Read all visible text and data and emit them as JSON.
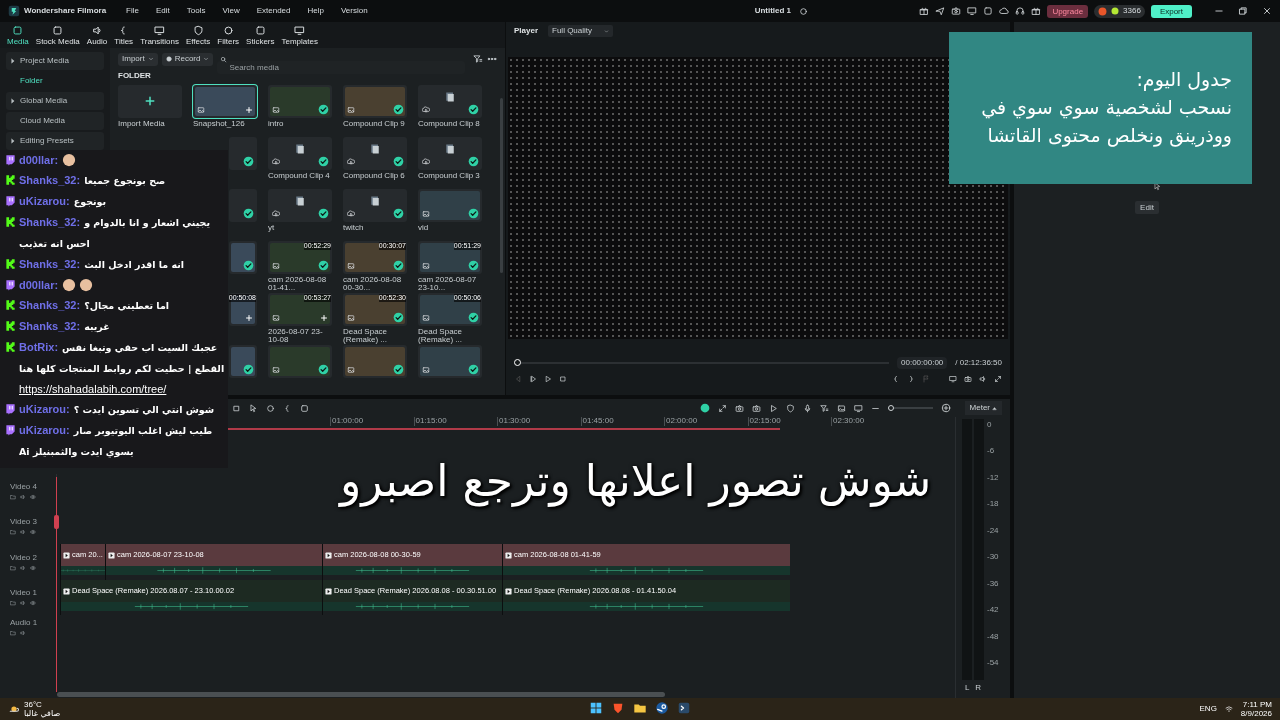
{
  "title_bar": {
    "app_name": "Wondershare Filmora",
    "menu": [
      "File",
      "Edit",
      "Tools",
      "View",
      "Extended",
      "Help",
      "Version"
    ],
    "project_title": "Untitled 1",
    "upgrade": "Upgrade",
    "credits": "3366",
    "export": "Export"
  },
  "tabs": [
    {
      "label": "Media",
      "selected": true
    },
    {
      "label": "Stock Media",
      "selected": false
    },
    {
      "label": "Audio",
      "selected": false
    },
    {
      "label": "Titles",
      "selected": false
    },
    {
      "label": "Transitions",
      "selected": false
    },
    {
      "label": "Effects",
      "selected": false
    },
    {
      "label": "Filters",
      "selected": false
    },
    {
      "label": "Stickers",
      "selected": false
    },
    {
      "label": "Templates",
      "selected": false
    }
  ],
  "sidebar": {
    "items": [
      {
        "label": "Project Media",
        "kind": "group",
        "selected": false
      },
      {
        "label": "Folder",
        "kind": "sub",
        "selected": true
      },
      {
        "label": "Global Media",
        "kind": "group",
        "selected": false
      },
      {
        "label": "Cloud Media",
        "kind": "plain",
        "selected": false
      },
      {
        "label": "Editing Presets",
        "kind": "group",
        "selected": false
      }
    ]
  },
  "media": {
    "import": "Import",
    "record": "Record",
    "search": {
      "placeholder": "Search media"
    },
    "section": "FOLDER",
    "items": [
      {
        "kind": "import",
        "label": "Import Media",
        "selected": false
      },
      {
        "kind": "photo",
        "label": "Snapshot_126",
        "selected": true,
        "added": false
      },
      {
        "kind": "photo",
        "label": "intro",
        "selected": false,
        "added": true
      },
      {
        "kind": "photo",
        "label": "Compound Clip 9",
        "selected": false,
        "added": true
      },
      {
        "kind": "compound",
        "label": "Compound Clip 8",
        "selected": false,
        "added": true
      },
      {
        "kind": "covered"
      },
      {
        "kind": "compound",
        "cut": true,
        "selected": false,
        "added": true
      },
      {
        "kind": "compound",
        "label": "Compound Clip 4",
        "selected": false,
        "added": true
      },
      {
        "kind": "compound",
        "label": "Compound Clip 6",
        "selected": false,
        "added": true
      },
      {
        "kind": "compound",
        "label": "Compound Clip 3",
        "selected": false,
        "added": true
      },
      {
        "kind": "covered"
      },
      {
        "kind": "compound",
        "cut": true,
        "selected": false,
        "added": true
      },
      {
        "kind": "compound",
        "label": "yt",
        "selected": false,
        "added": true
      },
      {
        "kind": "compound",
        "label": "twitch",
        "selected": false,
        "added": true
      },
      {
        "kind": "photo",
        "label": "vid",
        "selected": false,
        "added": true
      },
      {
        "kind": "covered"
      },
      {
        "kind": "photo",
        "cut": true,
        "selected": false,
        "added": true
      },
      {
        "kind": "video",
        "label": "cam 2026-08-08 01-41...",
        "duration": "00:52:29",
        "selected": false,
        "added": true
      },
      {
        "kind": "video",
        "label": "cam 2026-08-08 00-30...",
        "duration": "00:30:07",
        "selected": false,
        "added": true
      },
      {
        "kind": "video",
        "label": "cam 2026-08-07 23-10...",
        "duration": "00:51:29",
        "selected": false,
        "added": true
      },
      {
        "kind": "covered"
      },
      {
        "kind": "video",
        "cut": true,
        "duration": "00:50:08",
        "selected": false,
        "added": false
      },
      {
        "kind": "video",
        "label": "2026-08-07 23-10-08",
        "duration": "00:53:27",
        "selected": false,
        "added": false
      },
      {
        "kind": "video",
        "label": "Dead Space (Remake) ...",
        "duration": "00:52:30",
        "selected": false,
        "added": true
      },
      {
        "kind": "video",
        "label": "Dead Space (Remake) ...",
        "duration": "00:50:06",
        "selected": false,
        "added": true
      },
      {
        "kind": "covered"
      },
      {
        "kind": "image",
        "cut": true,
        "selected": false,
        "added": true
      },
      {
        "kind": "image",
        "selected": false,
        "added": true
      },
      {
        "kind": "image",
        "selected": false,
        "added": true
      },
      {
        "kind": "image",
        "selected": false,
        "added": true
      }
    ]
  },
  "player": {
    "label": "Player",
    "quality": "Full Quality",
    "current_time": "00:00:00:00",
    "total_time": "/ 02:12:36:50",
    "level": 0
  },
  "right_panel": {
    "button": "Edit"
  },
  "timeline": {
    "meter": "Meter",
    "zoom": {
      "level": 0
    },
    "ruler": [
      "01:00:00",
      "01:15:00",
      "01:30:00",
      "01:45:00",
      "02:00:00",
      "02:15:00",
      "02:30:00"
    ],
    "tracks": [
      {
        "name": "Video 4",
        "kind": "video"
      },
      {
        "name": "Video 3",
        "kind": "video"
      },
      {
        "name": "Video 2",
        "kind": "video",
        "clips": [
          "cam 20...",
          "cam 2026-08-07 23-10-08",
          "cam 2026-08-08 00-30-59",
          "cam 2026-08-08 01-41-59"
        ]
      },
      {
        "name": "Video 1",
        "kind": "video",
        "clips": [
          "Dead Space (Remake) 2026.08.07 - 23.10.00.02",
          "Dead Space (Remake) 2026.08.08 - 00.30.51.00",
          "Dead Space (Remake) 2026.08.08 - 01.41.50.04"
        ]
      },
      {
        "name": "Audio 1",
        "kind": "audio"
      }
    ],
    "meter_scale": [
      "0",
      "-6",
      "-12",
      "-18",
      "-24",
      "-30",
      "-36",
      "-42",
      "-48",
      "-54"
    ],
    "meter_channels": [
      "L",
      "R"
    ]
  },
  "chat": [
    {
      "kind": "twitch",
      "user": "d00llar:",
      "emotes": [
        {
          "kind": "face"
        }
      ]
    },
    {
      "kind": "kick",
      "user": "Shanks_32:",
      "text": "صح بونجوع جميعا"
    },
    {
      "kind": "twitch",
      "user": "uKizarou:",
      "text": "بونجوع"
    },
    {
      "kind": "kick",
      "user": "Shanks_32:",
      "text": "يجيني اشعار و انا بالدوام و احس انه تعذيب"
    },
    {
      "kind": "kick",
      "user": "Shanks_32:",
      "text": "انه ما اقدر ادخل البث"
    },
    {
      "kind": "twitch",
      "user": "d00llar:",
      "emotes": [
        {
          "kind": "face"
        },
        {
          "kind": "face"
        }
      ]
    },
    {
      "kind": "kick",
      "user": "Shanks_32:",
      "text": "اما تعطيني مجال؟"
    },
    {
      "kind": "kick",
      "user": "Shanks_32:",
      "text": "غريبه"
    },
    {
      "kind": "kick",
      "user": "BotRix:",
      "text": "عجبك السيت اب حقي وتبغا نفس القطع | حطيت لكم روابط المنتجات كلها هنا",
      "link": "https://shahadalabih.com/tree/"
    },
    {
      "kind": "twitch",
      "user": "uKizarou:",
      "text": "شوش انتي الي تسوين ايدت ؟"
    },
    {
      "kind": "twitch",
      "user": "uKizarou:",
      "text": "طيب ليش اغلب اليوتيوبر صار يسوي ايدت والثمبنيلز Ai"
    }
  ],
  "note": "جدول اليوم:\nنسحب لشخصية سوي سوي في\nووذرينق ونخلص محتوى القاتشا",
  "caption": "شوش تصور اعلانها وترجع اصبرو",
  "taskbar": {
    "temperature": "36°C",
    "weather": "صافي غالبا",
    "language": "ENG",
    "time": "7:11 PM",
    "date": "8/9/2026"
  }
}
